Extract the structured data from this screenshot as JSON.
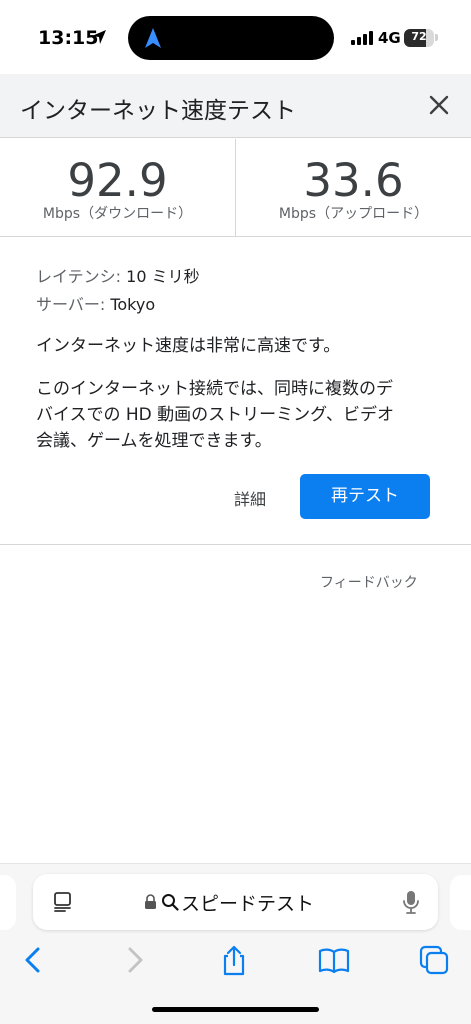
{
  "status_bar": {
    "time": "13:15",
    "network": "4G",
    "battery": "72",
    "battery_level": 0.72
  },
  "speed_test": {
    "title": "インターネット速度テスト",
    "download": {
      "value": "92.9",
      "unit": "Mbps（ダウンロード）"
    },
    "upload": {
      "value": "33.6",
      "unit": "Mbps（アップロード）"
    },
    "latency_label": "レイテンシ:",
    "latency_value": "10 ミリ秒",
    "server_label": "サーバー:",
    "server_value": "Tokyo",
    "summary": "インターネット速度は非常に高速です。",
    "description_line1": "このインターネット接続では、同時に複数のデ",
    "description_line2": "バイスでの HD 動画のストリーミング、ビデオ",
    "description_line3": "会議、ゲームを処理できます。",
    "details_label": "詳細",
    "retest_label": "再テスト",
    "feedback_label": "フィードバック"
  },
  "browser": {
    "url_text": "スピードテスト",
    "accent_color": "#0b7ff0"
  },
  "icons": [
    "location-arrow-icon",
    "navigation-icon",
    "signal-icon",
    "battery-icon",
    "close-icon",
    "reader-icon",
    "lock-icon",
    "search-icon",
    "microphone-icon",
    "back-icon",
    "forward-icon",
    "share-icon",
    "bookmarks-icon",
    "tabs-icon"
  ]
}
